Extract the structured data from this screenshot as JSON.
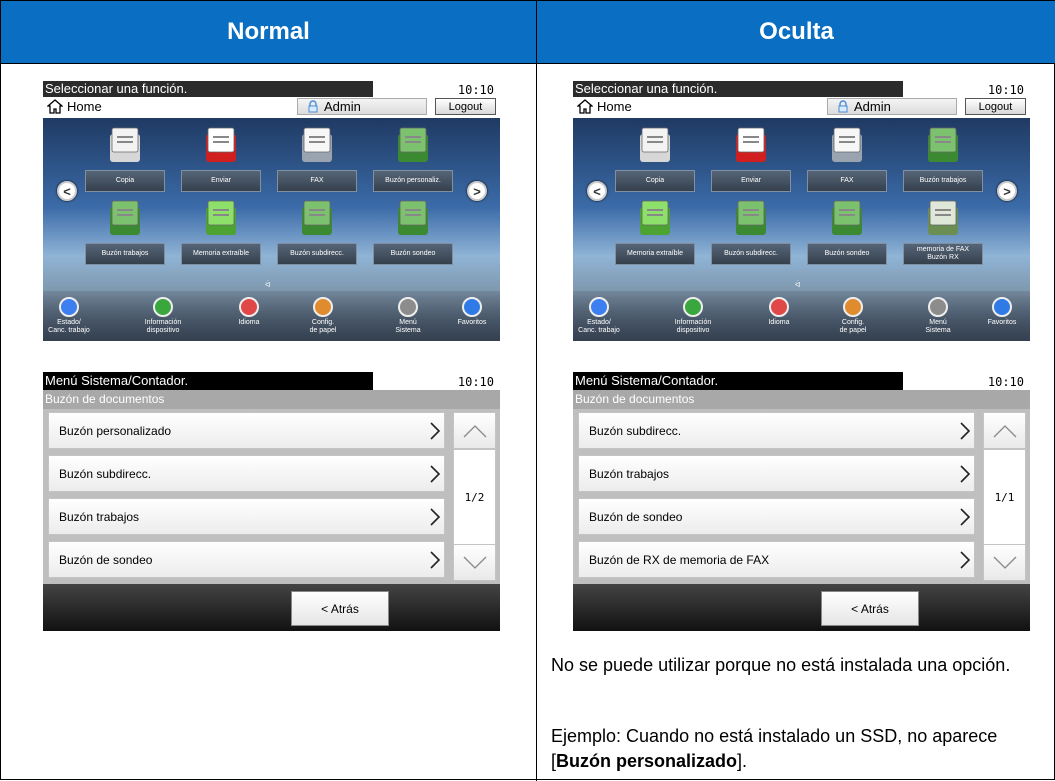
{
  "headers": {
    "left": "Normal",
    "right": "Oculta"
  },
  "home": {
    "title": "Seleccionar una función.",
    "time": "10:10",
    "home_label": "Home",
    "admin_label": "Admin",
    "logout_label": "Logout",
    "nav_prev": "<",
    "nav_next": ">",
    "divider": "ᐛ",
    "left_tiles": [
      "Copia",
      "Enviar",
      "FAX",
      "Buzón personaliz.",
      "Buzón trabajos",
      "Memoria extraíble",
      "Buzón subdirecc.",
      "Buzón sondeo"
    ],
    "right_tiles": [
      "Copia",
      "Enviar",
      "FAX",
      "Buzón trabajos",
      "Memoria extraíble",
      "Buzón subdirecc.",
      "Buzón sondeo",
      "memoria de FAX\nBuzón RX"
    ],
    "bottom_icons": [
      "Estado/\nCanc. trabajo",
      "Información\ndispositivo",
      "Idioma",
      "Config.\nde papel",
      "Menú\nSistema",
      "Favoritos"
    ]
  },
  "menu": {
    "title": "Menú Sistema/Contador.",
    "time": "10:10",
    "subtitle": "Buzón de documentos",
    "back_label": "< Atrás",
    "left_rows": [
      "Buzón personalizado",
      "Buzón subdirecc.",
      "Buzón trabajos",
      "Buzón de sondeo"
    ],
    "left_page": "1/2",
    "right_rows": [
      "Buzón subdirecc.",
      "Buzón trabajos",
      "Buzón de sondeo",
      "Buzón de RX de memoria de FAX"
    ],
    "right_page": "1/1"
  },
  "note": {
    "line1": "No se puede utilizar porque no está instalada una opción.",
    "example_prefix": "Ejemplo: Cuando no está instalado un SSD, no aparece [",
    "example_bold": "Buzón personalizado",
    "example_suffix": "]."
  }
}
